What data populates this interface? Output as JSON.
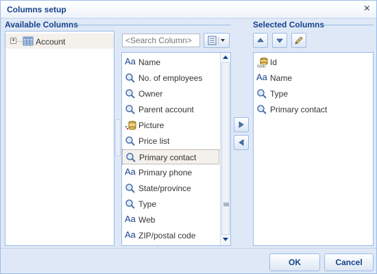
{
  "dialog": {
    "title": "Columns setup",
    "close_glyph": "×"
  },
  "available": {
    "title": "Available Columns",
    "tree": [
      {
        "label": "Account",
        "expander": "+",
        "icon": "table-grid-icon"
      }
    ]
  },
  "search": {
    "placeholder": "<Search Column>"
  },
  "column_list": [
    {
      "label": "Name",
      "icon": "text-aa-icon",
      "glyph": "Aa"
    },
    {
      "label": "No. of employees",
      "icon": "lookup-magnifier-icon",
      "glyph": ""
    },
    {
      "label": "Owner",
      "icon": "lookup-magnifier-icon",
      "glyph": ""
    },
    {
      "label": "Parent account",
      "icon": "lookup-magnifier-icon",
      "glyph": ""
    },
    {
      "label": "Picture",
      "icon": "image-database-icon",
      "glyph": ""
    },
    {
      "label": "Price list",
      "icon": "lookup-magnifier-icon",
      "glyph": ""
    },
    {
      "label": "Primary contact",
      "icon": "lookup-magnifier-icon",
      "glyph": "",
      "selected": true
    },
    {
      "label": "Primary phone",
      "icon": "text-aa-icon",
      "glyph": "Aa"
    },
    {
      "label": "State/province",
      "icon": "lookup-magnifier-icon",
      "glyph": ""
    },
    {
      "label": "Type",
      "icon": "lookup-magnifier-icon",
      "glyph": ""
    },
    {
      "label": "Web",
      "icon": "text-aa-icon",
      "glyph": "Aa"
    },
    {
      "label": "ZIP/postal code",
      "icon": "text-aa-icon",
      "glyph": "Aa"
    }
  ],
  "selected": {
    "title": "Selected Columns",
    "items": [
      {
        "label": "Id",
        "icon": "guid-key-icon",
        "glyph": ""
      },
      {
        "label": "Name",
        "icon": "text-aa-icon",
        "glyph": "Aa"
      },
      {
        "label": "Type",
        "icon": "lookup-magnifier-icon",
        "glyph": ""
      },
      {
        "label": "Primary contact",
        "icon": "lookup-magnifier-icon",
        "glyph": ""
      }
    ]
  },
  "buttons": {
    "ok": "OK",
    "cancel": "Cancel"
  },
  "colors": {
    "accent": "#15428b",
    "border": "#99bbe8",
    "background": "#dfe8f6",
    "selected_row": "#f4f0eb"
  }
}
